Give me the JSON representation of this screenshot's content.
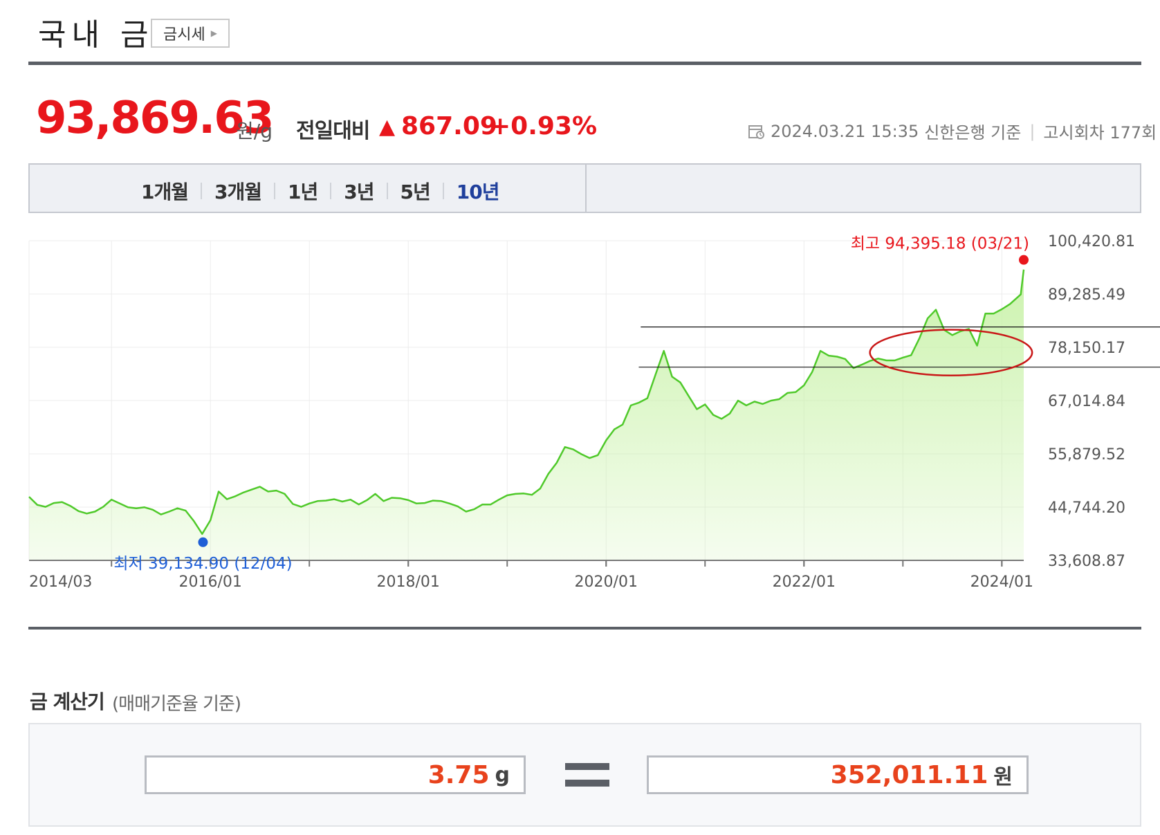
{
  "header": {
    "title": "국내 금",
    "gold_price_button": "금시세",
    "gold_price_button_icon": "triangle-right-icon"
  },
  "price": {
    "value": "93,869.63",
    "unit": "원/g",
    "change_label": "전일대비",
    "change_arrow": "▲",
    "change_value": "867.09",
    "change_percent": "+0.93%",
    "timestamp": "2024.03.21 15:35",
    "source": "신한은행 기준",
    "notice_round": "고시회차 177회",
    "up_color": "#e8161c"
  },
  "tabs": [
    {
      "label": "1개월",
      "active": false
    },
    {
      "label": "3개월",
      "active": false
    },
    {
      "label": "1년",
      "active": false
    },
    {
      "label": "3년",
      "active": false
    },
    {
      "label": "5년",
      "active": false
    },
    {
      "label": "10년",
      "active": true
    }
  ],
  "chart_data": {
    "type": "area",
    "y_ticks": [
      "100,420.81",
      "89,285.49",
      "78,150.17",
      "67,014.84",
      "55,879.52",
      "44,744.20",
      "33,608.87"
    ],
    "y_tick_values": [
      100420.81,
      89285.49,
      78150.17,
      67014.84,
      55879.52,
      44744.2,
      33608.87
    ],
    "ylim": [
      33608.87,
      100420.81
    ],
    "x_ticks": [
      "2014/03",
      "2016/01",
      "2018/01",
      "2020/01",
      "2022/01",
      "2024/01"
    ],
    "x_range": [
      "2014-03",
      "2024-03"
    ],
    "grid": true,
    "line_color": "#4fc92a",
    "fill_color": "#c9f2a9",
    "max_label": "최고 94,395.18 (03/21)",
    "max_point": {
      "date": "2024-03-21",
      "value": 94395.18
    },
    "min_label": "최저 39,134.90 (12/04)",
    "min_point": {
      "date": "2015-12-04",
      "value": 39134.9
    },
    "max_color": "#e8161c",
    "min_color": "#1f5fd6",
    "annotation": {
      "type": "ellipse-with-guide-lines",
      "color": "#c91818",
      "x_range": [
        "2022-09",
        "2024-03"
      ],
      "band": [
        74000,
        82400
      ]
    },
    "points": [
      [
        "2014-03",
        46900
      ],
      [
        "2014-04",
        45200
      ],
      [
        "2014-05",
        44800
      ],
      [
        "2014-06",
        45600
      ],
      [
        "2014-07",
        45800
      ],
      [
        "2014-08",
        45000
      ],
      [
        "2014-09",
        43900
      ],
      [
        "2014-10",
        43400
      ],
      [
        "2014-11",
        43800
      ],
      [
        "2014-12",
        44800
      ],
      [
        "2015-01",
        46300
      ],
      [
        "2015-02",
        45500
      ],
      [
        "2015-03",
        44700
      ],
      [
        "2015-04",
        44500
      ],
      [
        "2015-05",
        44700
      ],
      [
        "2015-06",
        44200
      ],
      [
        "2015-07",
        43200
      ],
      [
        "2015-08",
        43800
      ],
      [
        "2015-09",
        44500
      ],
      [
        "2015-10",
        44000
      ],
      [
        "2015-11",
        41800
      ],
      [
        "2015-12",
        39134.9
      ],
      [
        "2016-01",
        42000
      ],
      [
        "2016-02",
        48000
      ],
      [
        "2016-03",
        46400
      ],
      [
        "2016-04",
        47000
      ],
      [
        "2016-05",
        47800
      ],
      [
        "2016-06",
        48400
      ],
      [
        "2016-07",
        49000
      ],
      [
        "2016-08",
        48000
      ],
      [
        "2016-09",
        48200
      ],
      [
        "2016-10",
        47500
      ],
      [
        "2016-11",
        45400
      ],
      [
        "2016-12",
        44800
      ],
      [
        "2017-01",
        45500
      ],
      [
        "2017-02",
        46000
      ],
      [
        "2017-03",
        46100
      ],
      [
        "2017-04",
        46400
      ],
      [
        "2017-05",
        45900
      ],
      [
        "2017-06",
        46300
      ],
      [
        "2017-07",
        45300
      ],
      [
        "2017-08",
        46200
      ],
      [
        "2017-09",
        47500
      ],
      [
        "2017-10",
        46000
      ],
      [
        "2017-11",
        46700
      ],
      [
        "2017-12",
        46600
      ],
      [
        "2018-01",
        46200
      ],
      [
        "2018-02",
        45500
      ],
      [
        "2018-03",
        45600
      ],
      [
        "2018-04",
        46100
      ],
      [
        "2018-05",
        46000
      ],
      [
        "2018-06",
        45500
      ],
      [
        "2018-07",
        44900
      ],
      [
        "2018-08",
        43800
      ],
      [
        "2018-09",
        44300
      ],
      [
        "2018-10",
        45300
      ],
      [
        "2018-11",
        45300
      ],
      [
        "2018-12",
        46300
      ],
      [
        "2019-01",
        47200
      ],
      [
        "2019-02",
        47500
      ],
      [
        "2019-03",
        47600
      ],
      [
        "2019-04",
        47300
      ],
      [
        "2019-05",
        48600
      ],
      [
        "2019-06",
        51700
      ],
      [
        "2019-07",
        54000
      ],
      [
        "2019-08",
        57300
      ],
      [
        "2019-09",
        56800
      ],
      [
        "2019-10",
        55800
      ],
      [
        "2019-11",
        55000
      ],
      [
        "2019-12",
        55600
      ],
      [
        "2020-01",
        58700
      ],
      [
        "2020-02",
        61000
      ],
      [
        "2020-03",
        62000
      ],
      [
        "2020-04",
        66000
      ],
      [
        "2020-05",
        66600
      ],
      [
        "2020-06",
        67500
      ],
      [
        "2020-07",
        72500
      ],
      [
        "2020-08",
        77400
      ],
      [
        "2020-09",
        72000
      ],
      [
        "2020-10",
        70800
      ],
      [
        "2020-11",
        68000
      ],
      [
        "2020-12",
        65200
      ],
      [
        "2021-01",
        66200
      ],
      [
        "2021-02",
        64000
      ],
      [
        "2021-03",
        63200
      ],
      [
        "2021-04",
        64300
      ],
      [
        "2021-05",
        67000
      ],
      [
        "2021-06",
        66000
      ],
      [
        "2021-07",
        66800
      ],
      [
        "2021-08",
        66300
      ],
      [
        "2021-09",
        67000
      ],
      [
        "2021-10",
        67300
      ],
      [
        "2021-11",
        68600
      ],
      [
        "2021-12",
        68800
      ],
      [
        "2022-01",
        70200
      ],
      [
        "2022-02",
        73000
      ],
      [
        "2022-03",
        77400
      ],
      [
        "2022-04",
        76400
      ],
      [
        "2022-05",
        76200
      ],
      [
        "2022-06",
        75700
      ],
      [
        "2022-07",
        73800
      ],
      [
        "2022-08",
        74500
      ],
      [
        "2022-09",
        75300
      ],
      [
        "2022-10",
        75800
      ],
      [
        "2022-11",
        75400
      ],
      [
        "2022-12",
        75400
      ],
      [
        "2023-01",
        76000
      ],
      [
        "2023-02",
        76500
      ],
      [
        "2023-03",
        80000
      ],
      [
        "2023-04",
        84200
      ],
      [
        "2023-05",
        86000
      ],
      [
        "2023-06",
        81800
      ],
      [
        "2023-07",
        80700
      ],
      [
        "2023-08",
        81500
      ],
      [
        "2023-09",
        82000
      ],
      [
        "2023-10",
        78500
      ],
      [
        "2023-11",
        85200
      ],
      [
        "2023-12",
        85200
      ],
      [
        "2024-01",
        86100
      ],
      [
        "2024-02",
        87200
      ],
      [
        "2024-03-10",
        89200
      ],
      [
        "2024-03-21",
        94395.18
      ]
    ]
  },
  "calculator": {
    "title": "금 계산기",
    "subtitle": "(매매기준율 기준)",
    "gram_value": "3.75",
    "gram_unit": "g",
    "won_value": "352,011.11",
    "won_unit": "원",
    "equals_icon": "equals-icon",
    "value_color": "#e8421c"
  }
}
